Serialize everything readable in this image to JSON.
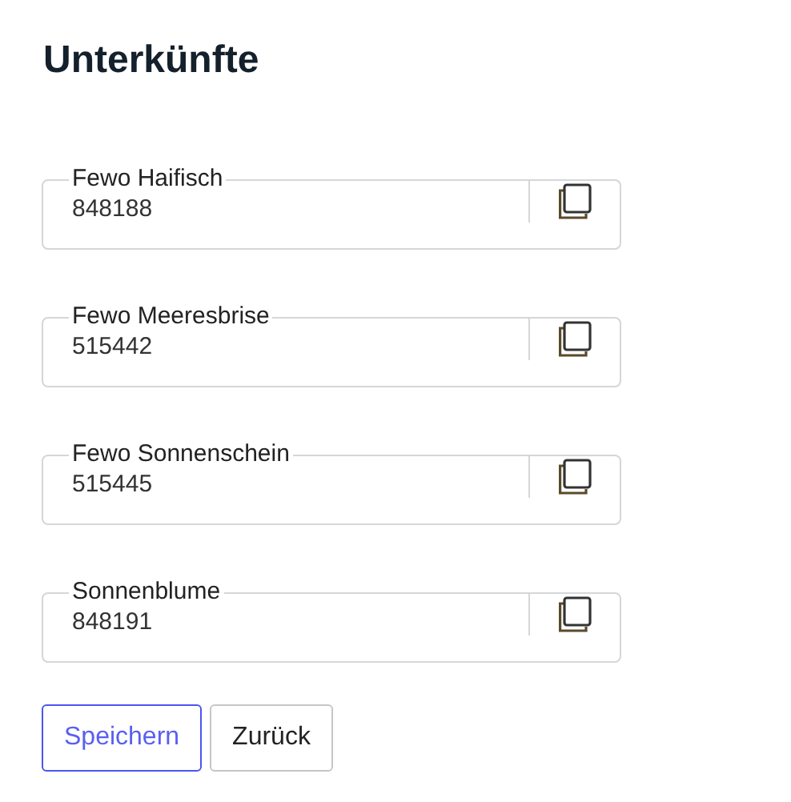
{
  "title": "Unterkünfte",
  "accommodations": [
    {
      "label": "Fewo Haifisch",
      "value": "848188"
    },
    {
      "label": "Fewo Meeresbrise",
      "value": "515442"
    },
    {
      "label": "Fewo Sonnenschein",
      "value": "515445"
    },
    {
      "label": "Sonnenblume",
      "value": "848191"
    }
  ],
  "buttons": [
    {
      "label": "Speichern",
      "kind": "primary"
    },
    {
      "label": "Zurück",
      "kind": "secondary"
    }
  ]
}
